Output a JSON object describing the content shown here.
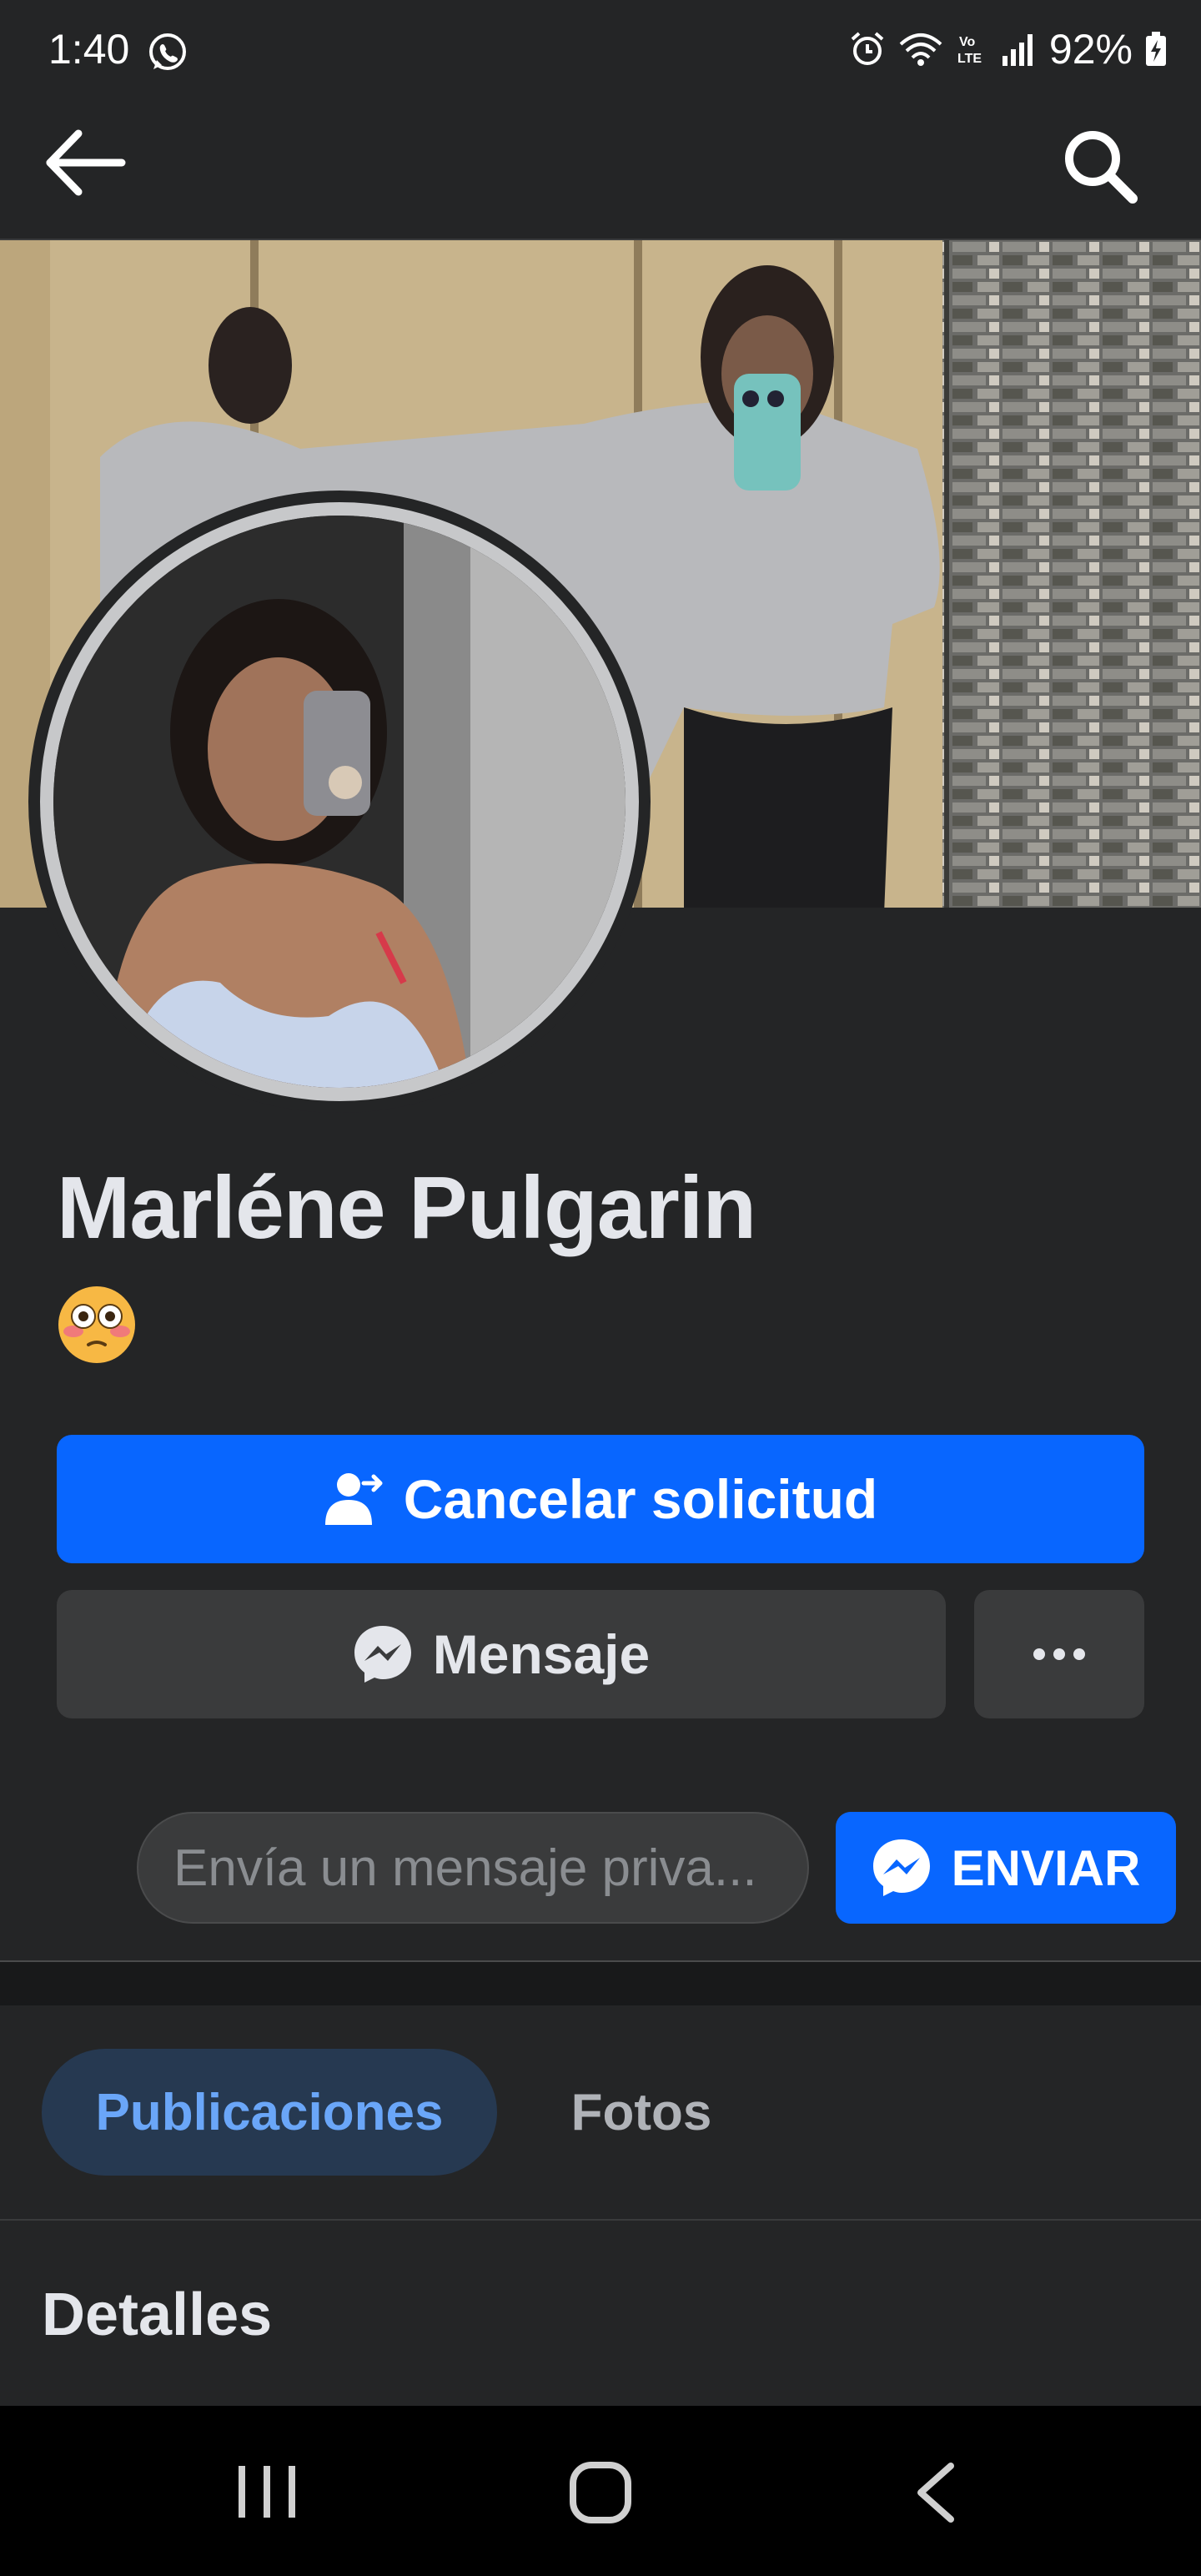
{
  "status_bar": {
    "time": "1:40",
    "battery": "92%"
  },
  "profile": {
    "name": "Marléne Pulgarin",
    "bio_emoji": "😳"
  },
  "actions": {
    "cancel_request_label": "Cancelar solicitud",
    "message_label": "Mensaje"
  },
  "private_message": {
    "placeholder": "Envía un mensaje priva...",
    "send_label": "ENVIAR"
  },
  "tabs": [
    {
      "label": "Publicaciones",
      "active": true
    },
    {
      "label": "Fotos",
      "active": false
    }
  ],
  "section_title": "Detalles",
  "colors": {
    "accent": "#0866ff",
    "background": "#242526",
    "secondary_button": "#3a3b3c",
    "active_tab_bg": "#263951",
    "active_tab_text": "#6aa6f8"
  },
  "icons": [
    "whatsapp-icon",
    "alarm-icon",
    "wifi-icon",
    "volte-icon",
    "signal-icon",
    "battery-icon",
    "back-arrow-icon",
    "search-icon",
    "add-friend-pending-icon",
    "messenger-icon",
    "more-dots-icon",
    "recent-apps-icon",
    "home-icon",
    "nav-back-icon"
  ]
}
